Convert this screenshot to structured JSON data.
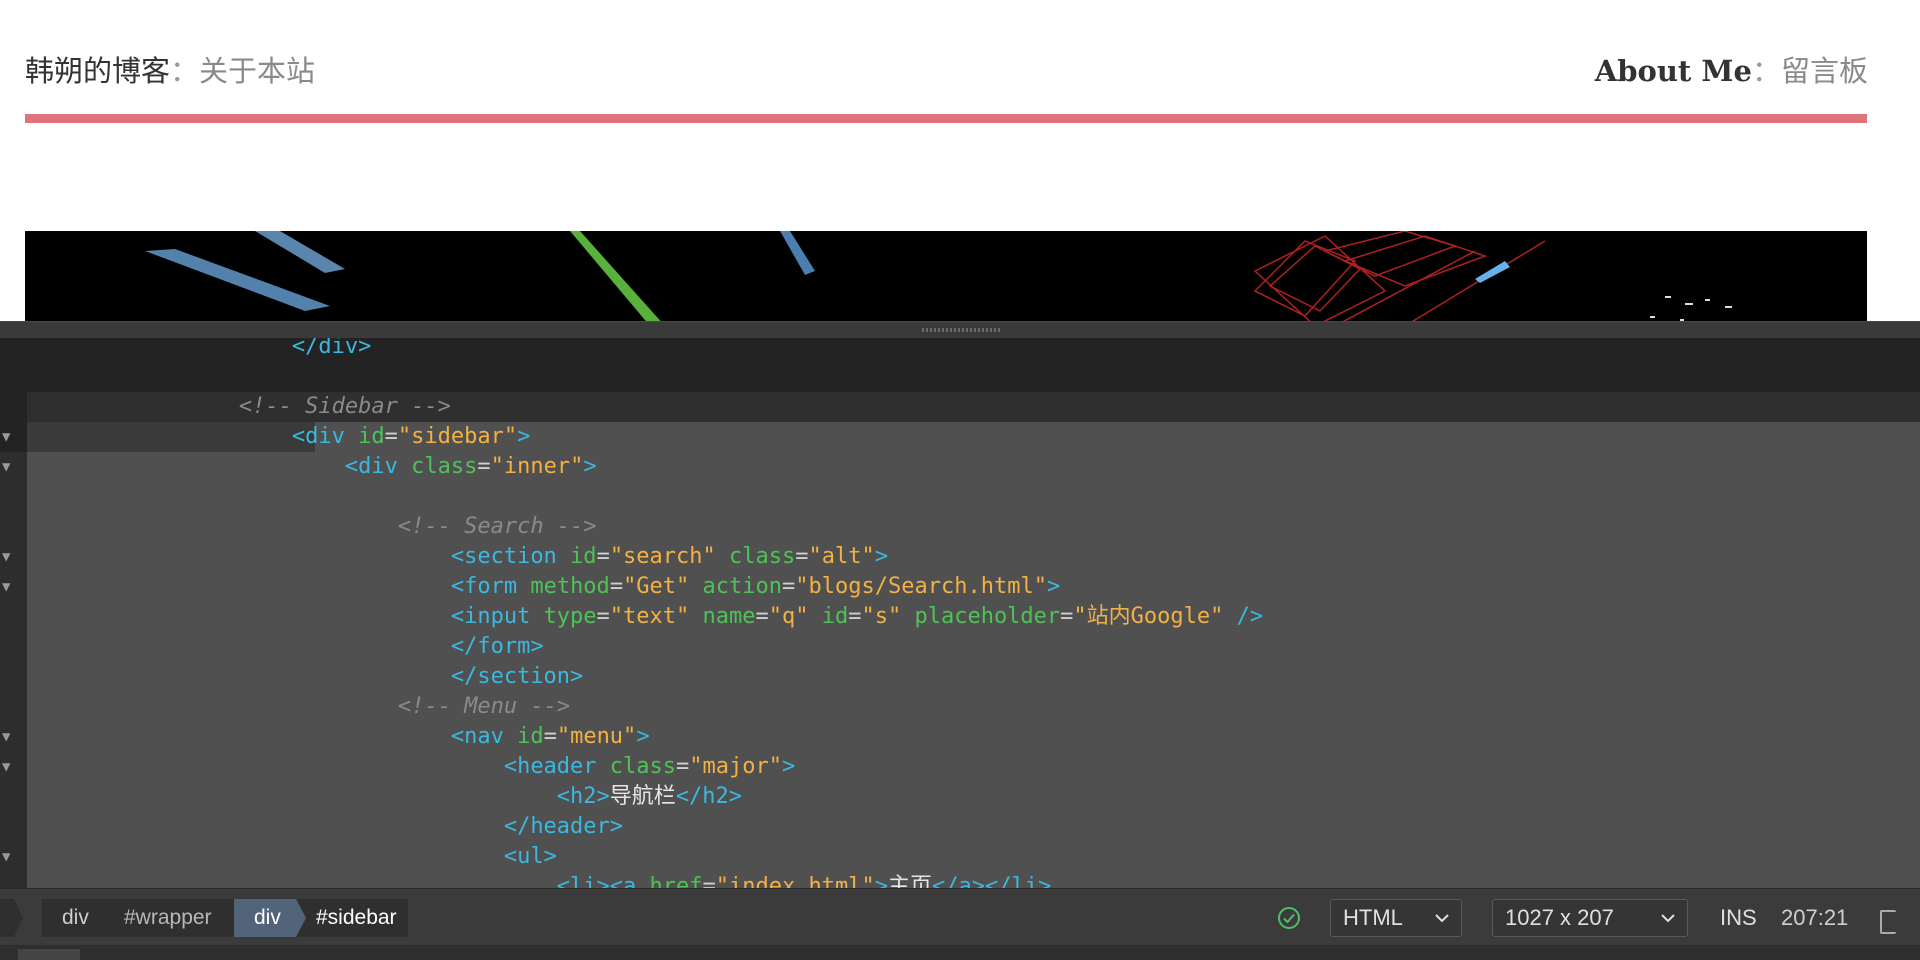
{
  "site_nav": {
    "left_title": "韩朔的博客",
    "left_sep": "：",
    "left_link": "关于本站",
    "right_title": "About Me",
    "right_sep": "：",
    "right_link": "留言板"
  },
  "colors": {
    "accent_bar": "#e0727a",
    "tag": "#3bb8e0",
    "attribute": "#4ec257",
    "string": "#f3b145",
    "comment": "#8a8a8a",
    "selection": "#505050",
    "crumb_active": "#52647a"
  },
  "code_lines": [
    {
      "tokens": [
        {
          "k": "t",
          "v": "                    </div>"
        }
      ]
    },
    {
      "tokens": []
    },
    {
      "tokens": [
        {
          "k": "c",
          "v": "                <!-- Sidebar -->"
        }
      ]
    },
    {
      "tokens": [
        {
          "k": "t",
          "v": "                    <div "
        },
        {
          "k": "a",
          "v": "id"
        },
        {
          "k": "p",
          "v": "="
        },
        {
          "k": "s",
          "v": "\"sidebar\""
        },
        {
          "k": "t",
          "v": ">"
        }
      ]
    },
    {
      "tokens": [
        {
          "k": "t",
          "v": "                        <div "
        },
        {
          "k": "a",
          "v": "class"
        },
        {
          "k": "p",
          "v": "="
        },
        {
          "k": "s",
          "v": "\"inner\""
        },
        {
          "k": "t",
          "v": ">"
        }
      ]
    },
    {
      "tokens": []
    },
    {
      "tokens": [
        {
          "k": "c",
          "v": "                            <!-- Search -->"
        }
      ]
    },
    {
      "tokens": [
        {
          "k": "t",
          "v": "                                <section "
        },
        {
          "k": "a",
          "v": "id"
        },
        {
          "k": "p",
          "v": "="
        },
        {
          "k": "s",
          "v": "\"search\" "
        },
        {
          "k": "a",
          "v": "class"
        },
        {
          "k": "p",
          "v": "="
        },
        {
          "k": "s",
          "v": "\"alt\""
        },
        {
          "k": "t",
          "v": ">"
        }
      ]
    },
    {
      "tokens": [
        {
          "k": "t",
          "v": "                                <form "
        },
        {
          "k": "a",
          "v": "method"
        },
        {
          "k": "p",
          "v": "="
        },
        {
          "k": "s",
          "v": "\"Get\" "
        },
        {
          "k": "a",
          "v": "action"
        },
        {
          "k": "p",
          "v": "="
        },
        {
          "k": "s",
          "v": "\"blogs/Search.html\""
        },
        {
          "k": "t",
          "v": ">"
        }
      ]
    },
    {
      "tokens": [
        {
          "k": "t",
          "v": "                                <input "
        },
        {
          "k": "a",
          "v": "type"
        },
        {
          "k": "p",
          "v": "="
        },
        {
          "k": "s",
          "v": "\"text\" "
        },
        {
          "k": "a",
          "v": "name"
        },
        {
          "k": "p",
          "v": "="
        },
        {
          "k": "s",
          "v": "\"q\" "
        },
        {
          "k": "a",
          "v": "id"
        },
        {
          "k": "p",
          "v": "="
        },
        {
          "k": "s",
          "v": "\"s\" "
        },
        {
          "k": "a",
          "v": "placeholder"
        },
        {
          "k": "p",
          "v": "="
        },
        {
          "k": "s",
          "v": "\"站内Google\" "
        },
        {
          "k": "t",
          "v": "/>"
        }
      ]
    },
    {
      "tokens": [
        {
          "k": "t",
          "v": "                                </form>"
        }
      ]
    },
    {
      "tokens": [
        {
          "k": "t",
          "v": "                                </section>"
        }
      ]
    },
    {
      "tokens": [
        {
          "k": "c",
          "v": "                            <!-- Menu -->"
        }
      ]
    },
    {
      "tokens": [
        {
          "k": "t",
          "v": "                                <nav "
        },
        {
          "k": "a",
          "v": "id"
        },
        {
          "k": "p",
          "v": "="
        },
        {
          "k": "s",
          "v": "\"menu\""
        },
        {
          "k": "t",
          "v": ">"
        }
      ]
    },
    {
      "tokens": [
        {
          "k": "t",
          "v": "                                    <header "
        },
        {
          "k": "a",
          "v": "class"
        },
        {
          "k": "p",
          "v": "="
        },
        {
          "k": "s",
          "v": "\"major\""
        },
        {
          "k": "t",
          "v": ">"
        }
      ]
    },
    {
      "tokens": [
        {
          "k": "t",
          "v": "                                        <h2>"
        },
        {
          "k": "w",
          "v": "导航栏"
        },
        {
          "k": "t",
          "v": "</h2>"
        }
      ]
    },
    {
      "tokens": [
        {
          "k": "t",
          "v": "                                    </header>"
        }
      ]
    },
    {
      "tokens": [
        {
          "k": "t",
          "v": "                                    <ul>"
        }
      ]
    },
    {
      "tokens": [
        {
          "k": "t",
          "v": "                                        <li><a "
        },
        {
          "k": "a",
          "v": "href"
        },
        {
          "k": "p",
          "v": "="
        },
        {
          "k": "s",
          "v": "\"index.html\""
        },
        {
          "k": "t",
          "v": ">"
        },
        {
          "k": "w",
          "v": "主页"
        },
        {
          "k": "t",
          "v": "</a></li>"
        }
      ]
    }
  ],
  "status_bar": {
    "crumb1_tag": "div",
    "crumb1_id": "#wrapper",
    "crumb2_tag": "div",
    "crumb2_id": "#sidebar",
    "language": "HTML",
    "dimensions": "1027 x 207",
    "mode": "INS",
    "cursor": "207:21"
  },
  "icons": [
    "check-circle-icon",
    "chevron-down-icon",
    "fold-triangle-icon",
    "panel-edge-icon"
  ]
}
